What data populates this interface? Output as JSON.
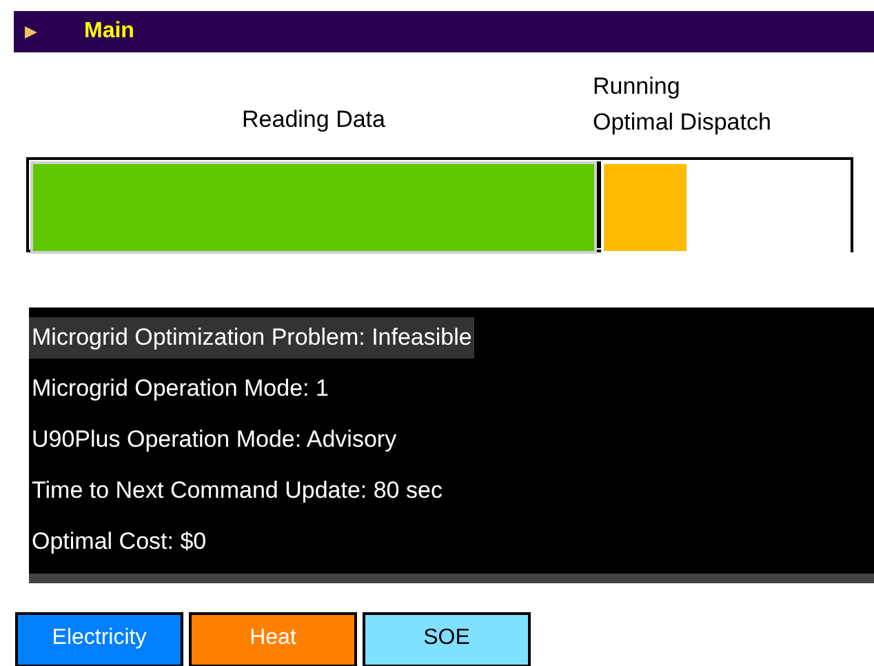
{
  "header": {
    "title": "Main",
    "expanded": false
  },
  "stages": [
    {
      "label": "Reading Data",
      "level": 1,
      "color": "#5fc700"
    },
    {
      "label": "Running\nOptimal Dispatch",
      "level": 0.34,
      "color": "#ffbb00"
    }
  ],
  "status_lines": [
    {
      "text": "Microgrid Optimization Problem: Infeasible",
      "selected": true
    },
    {
      "text": "Microgrid Operation Mode: 1",
      "selected": false
    },
    {
      "text": "U90Plus Operation Mode: Advisory",
      "selected": false
    },
    {
      "text": "Time to Next Command Update: 80 sec",
      "selected": false
    },
    {
      "text": "Optimal Cost: $0",
      "selected": false
    }
  ],
  "tabs": [
    {
      "label": "Electricity",
      "color": "#0080ff"
    },
    {
      "label": "Heat",
      "color": "#ff8000"
    },
    {
      "label": "SOE",
      "color": "#80e0ff"
    }
  ]
}
